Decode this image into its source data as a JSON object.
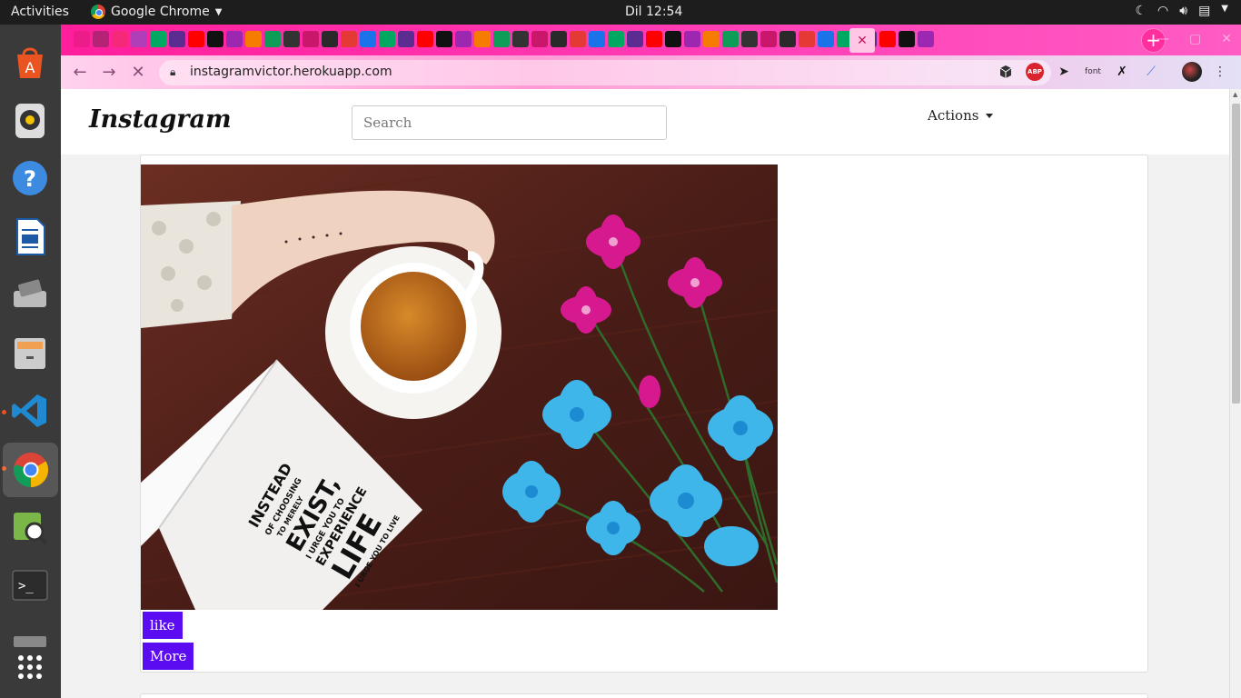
{
  "topbar": {
    "activities": "Activities",
    "app_name": "Google Chrome",
    "clock": "Dil 12:54"
  },
  "dock": {
    "items": [
      "software-center",
      "rhythmbox",
      "help",
      "writer",
      "scanner",
      "files",
      "vscode",
      "chrome",
      "image-viewer",
      "terminal",
      "keyboard",
      "show-apps"
    ]
  },
  "browser": {
    "url": "instagramvictor.herokuapp.com",
    "accent": "#ff2e9e",
    "extensions": [
      "cube-ext",
      "ABP",
      "cursor-ext",
      "font",
      "ninja-ext",
      "wand-ext",
      "profile"
    ]
  },
  "page": {
    "brand": "Instagram",
    "search_placeholder": "Search",
    "actions_label": "Actions",
    "post": {
      "book_lines": [
        "INSTEAD",
        "OF CHOOSING",
        "TO MERELY",
        "EXIST,",
        "I URGE YOU TO",
        "EXPERIENCE",
        "LIFE",
        "I URGE YOU TO LIVE"
      ],
      "like_label": "like",
      "more_label": "More",
      "button_color": "#5b0cf0"
    }
  }
}
